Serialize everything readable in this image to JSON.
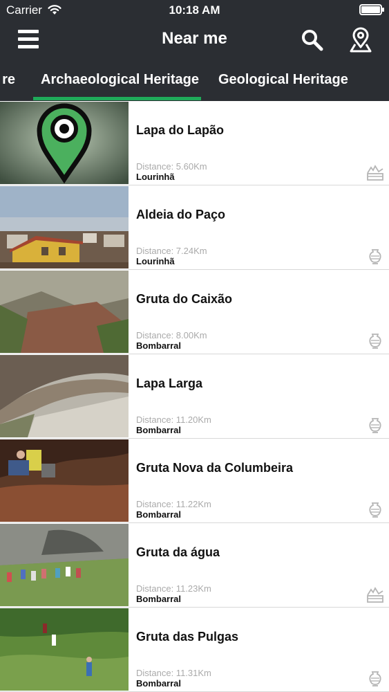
{
  "status_bar": {
    "carrier": "Carrier",
    "time": "10:18 AM"
  },
  "nav": {
    "title": "Near me"
  },
  "tabs": {
    "previous_partial": "re",
    "active": "Archaeological Heritage",
    "next": "Geological Heritage"
  },
  "colors": {
    "header_bg": "#2b2e33",
    "tab_indicator": "#1faa59",
    "distance_text": "#aaaaaa"
  },
  "items": [
    {
      "title": "Lapa do Lapão",
      "distance": "Distance: 5.60Km",
      "place": "Lourinhã",
      "category_icon": "landscape-icon"
    },
    {
      "title": "Aldeia do Paço",
      "distance": "Distance: 7.24Km",
      "place": "Lourinhã",
      "category_icon": "amphora-icon"
    },
    {
      "title": "Gruta do Caixão",
      "distance": "Distance: 8.00Km",
      "place": "Bombarral",
      "category_icon": "amphora-icon"
    },
    {
      "title": "Lapa Larga",
      "distance": "Distance: 11.20Km",
      "place": "Bombarral",
      "category_icon": "amphora-icon"
    },
    {
      "title": "Gruta Nova da Columbeira",
      "distance": "Distance: 11.22Km",
      "place": "Bombarral",
      "category_icon": "amphora-icon"
    },
    {
      "title": "Gruta da água",
      "distance": "Distance: 11.23Km",
      "place": "Bombarral",
      "category_icon": "landscape-icon"
    },
    {
      "title": "Gruta das Pulgas",
      "distance": "Distance: 11.31Km",
      "place": "Bombarral",
      "category_icon": "amphora-icon"
    }
  ]
}
